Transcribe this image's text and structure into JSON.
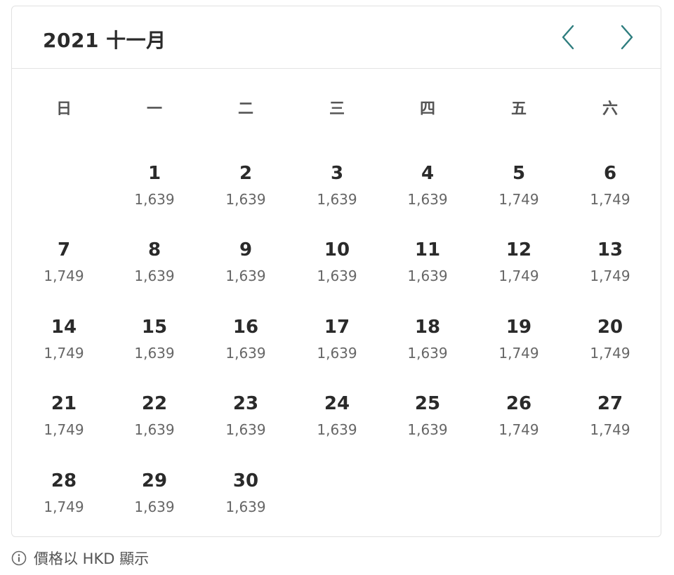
{
  "calendar": {
    "title": "2021 十一月",
    "nav": {
      "prev_icon": "chevron-left-icon",
      "next_icon": "chevron-right-icon",
      "accent_color": "#2e7d7e"
    },
    "weekdays": [
      "日",
      "一",
      "二",
      "三",
      "四",
      "五",
      "六"
    ],
    "first_weekday_offset": 1,
    "days": [
      {
        "day": "1",
        "price": "1,639"
      },
      {
        "day": "2",
        "price": "1,639"
      },
      {
        "day": "3",
        "price": "1,639"
      },
      {
        "day": "4",
        "price": "1,639"
      },
      {
        "day": "5",
        "price": "1,749"
      },
      {
        "day": "6",
        "price": "1,749"
      },
      {
        "day": "7",
        "price": "1,749"
      },
      {
        "day": "8",
        "price": "1,639"
      },
      {
        "day": "9",
        "price": "1,639"
      },
      {
        "day": "10",
        "price": "1,639"
      },
      {
        "day": "11",
        "price": "1,639"
      },
      {
        "day": "12",
        "price": "1,749"
      },
      {
        "day": "13",
        "price": "1,749"
      },
      {
        "day": "14",
        "price": "1,749"
      },
      {
        "day": "15",
        "price": "1,639"
      },
      {
        "day": "16",
        "price": "1,639"
      },
      {
        "day": "17",
        "price": "1,639"
      },
      {
        "day": "18",
        "price": "1,639"
      },
      {
        "day": "19",
        "price": "1,749"
      },
      {
        "day": "20",
        "price": "1,749"
      },
      {
        "day": "21",
        "price": "1,749"
      },
      {
        "day": "22",
        "price": "1,639"
      },
      {
        "day": "23",
        "price": "1,639"
      },
      {
        "day": "24",
        "price": "1,639"
      },
      {
        "day": "25",
        "price": "1,639"
      },
      {
        "day": "26",
        "price": "1,749"
      },
      {
        "day": "27",
        "price": "1,749"
      },
      {
        "day": "28",
        "price": "1,749"
      },
      {
        "day": "29",
        "price": "1,639"
      },
      {
        "day": "30",
        "price": "1,639"
      }
    ]
  },
  "footer": {
    "info_icon": "info-icon",
    "note": "價格以 HKD 顯示"
  }
}
